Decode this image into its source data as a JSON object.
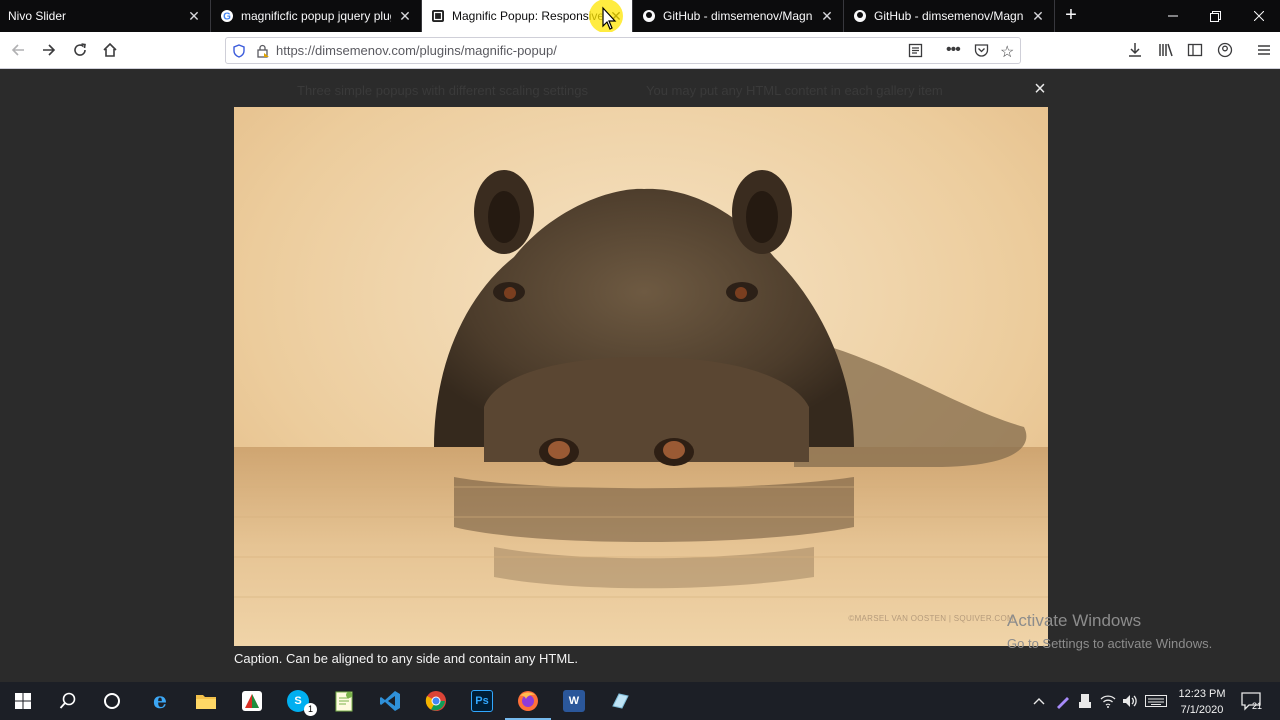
{
  "browser": {
    "tabs": [
      {
        "label": "Nivo Slider",
        "favicon": "blank-page-icon"
      },
      {
        "label": "magnificfic popup jquery plugin",
        "favicon": "google-icon"
      },
      {
        "label": "Magnific Popup: Responsive jQ",
        "favicon": "magnific-icon"
      },
      {
        "label": "GitHub - dimsemenov/Magnific",
        "favicon": "github-icon"
      },
      {
        "label": "GitHub - dimsemenov/Magnific",
        "favicon": "github-icon"
      }
    ],
    "active_tab_index": 2,
    "url": "https://dimsemenov.com/plugins/magnific-popup/"
  },
  "page": {
    "bg_hint_left": "Three simple popups with different scaling settings",
    "bg_hint_right": "You may put any HTML content in each gallery item",
    "caption": "Caption. Can be aligned to any side and contain any HTML.",
    "photo_credit": "©MARSEL VAN OOSTEN | SQUIVER.COM",
    "close_symbol": "×"
  },
  "windows": {
    "activate_title": "Activate Windows",
    "activate_sub": "Go to Settings to activate Windows."
  },
  "taskbar": {
    "time": "12:23 PM",
    "date": "7/1/2020",
    "notification_count": "21",
    "skype_badge": "1"
  },
  "colors": {
    "overlay": "#2b2b2b",
    "tabbar": "#0c0c0d",
    "taskbar": "#1c1f26",
    "cursor_highlight": "#ffe600"
  }
}
